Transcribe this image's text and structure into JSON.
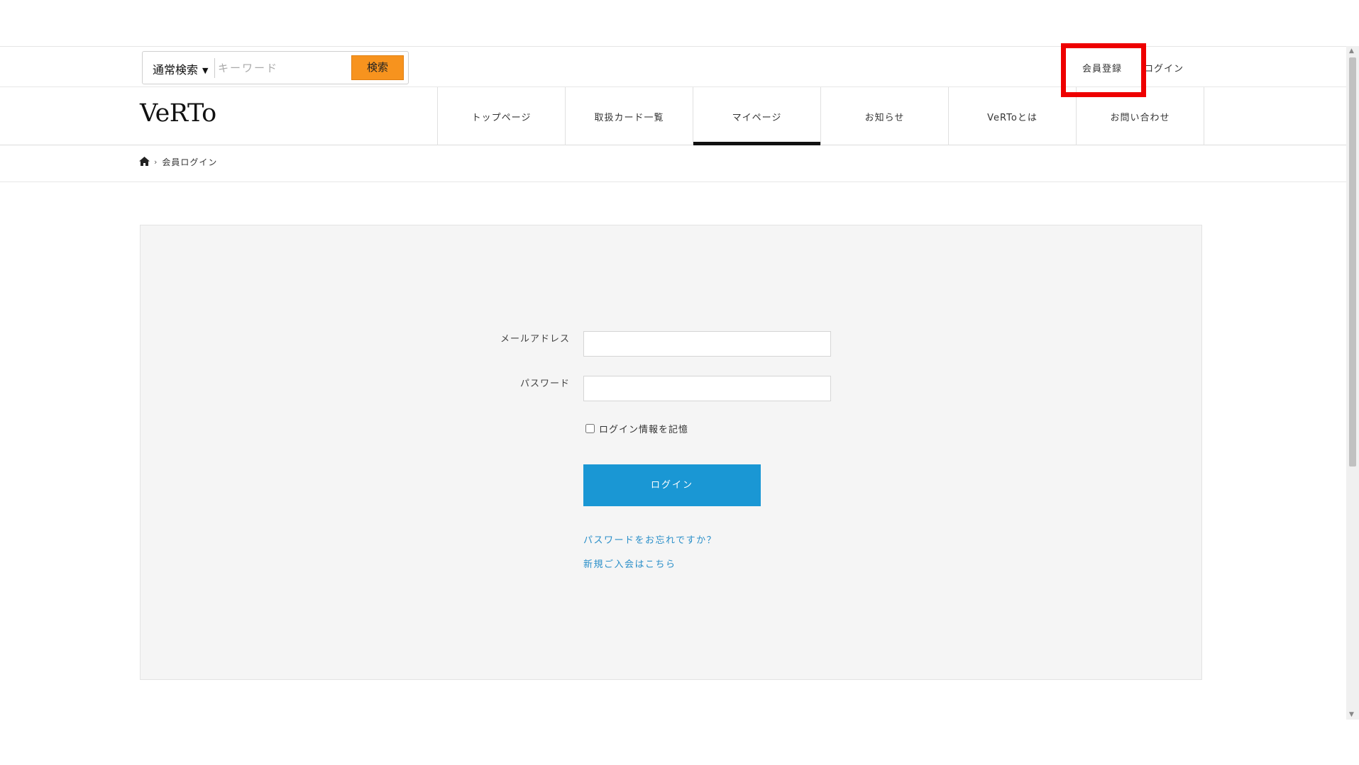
{
  "search": {
    "mode": "通常検索",
    "placeholder": "キーワード",
    "button": "検索"
  },
  "member_links": {
    "register": "会員登録",
    "login": "ログイン"
  },
  "logo": "VeRTo",
  "nav": [
    {
      "label": "トップページ"
    },
    {
      "label": "取扱カード一覧"
    },
    {
      "label": "マイページ",
      "active": true
    },
    {
      "label": "お知らせ"
    },
    {
      "label": "VeRToとは"
    },
    {
      "label": "お問い合わせ"
    }
  ],
  "breadcrumb": {
    "home_icon": "home-icon",
    "current": "会員ログイン"
  },
  "form": {
    "email_label": "メールアドレス",
    "password_label": "パスワード",
    "remember_label": "ログイン情報を記憶",
    "remember_checked": false,
    "submit": "ログイン",
    "forgot_link": "パスワードをお忘れですか？",
    "signup_link": "新規ご入会はこちら"
  },
  "colors": {
    "search_button": "#f7931e",
    "login_button": "#1a97d4",
    "link": "#2a8fc9",
    "highlight": "#ee0000"
  }
}
